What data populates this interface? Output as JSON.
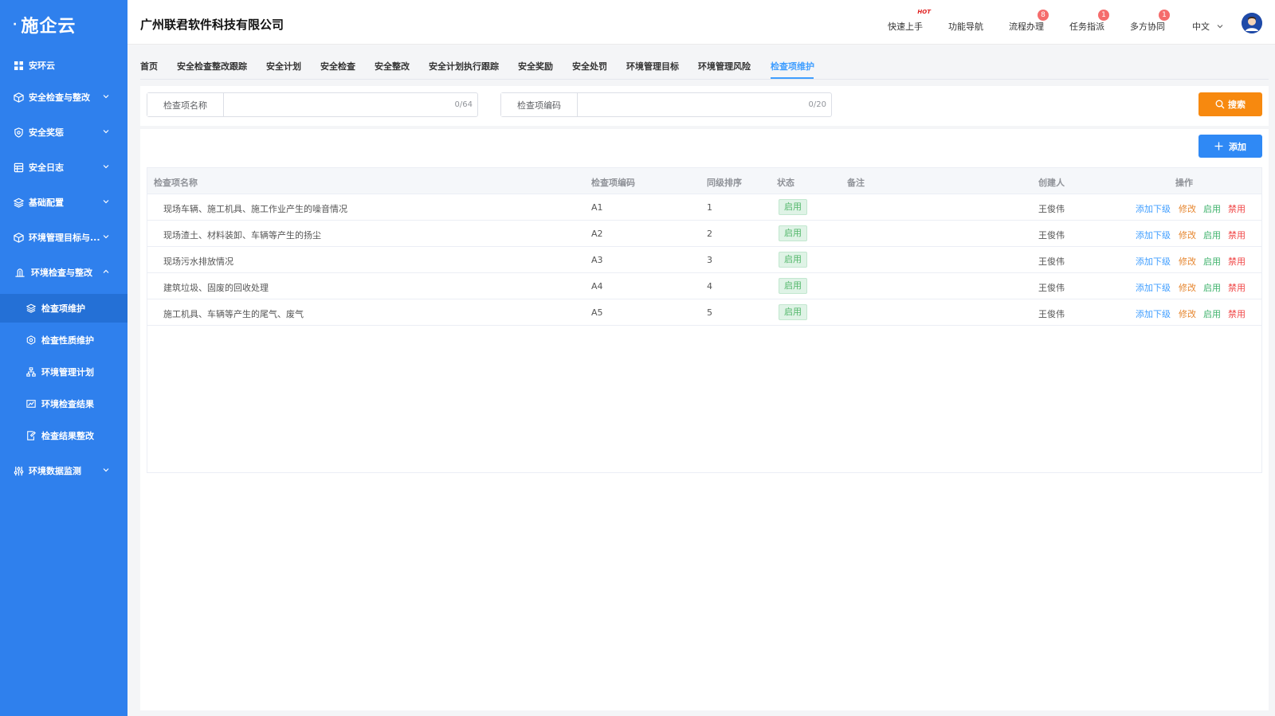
{
  "app": {
    "logo_text": "施企云",
    "company": "广州联君软件科技有限公司"
  },
  "sidebar": {
    "home": "安环云",
    "items": [
      {
        "label": "安全检查与整改",
        "icon": "cube-icon"
      },
      {
        "label": "安全奖惩",
        "icon": "shield-icon"
      },
      {
        "label": "安全日志",
        "icon": "calendar-icon"
      },
      {
        "label": "基础配置",
        "icon": "layers-icon"
      },
      {
        "label": "环境管理目标与...",
        "icon": "cube-icon"
      },
      {
        "label": "环境检查与整改",
        "icon": "plant-icon"
      },
      {
        "label": "环境数据监测",
        "icon": "sliders-icon"
      }
    ],
    "subitems": [
      {
        "label": "检查项维护",
        "icon": "layers-icon"
      },
      {
        "label": "检查性质维护",
        "icon": "hexagon-icon"
      },
      {
        "label": "环境管理计划",
        "icon": "org-chart-icon"
      },
      {
        "label": "环境检查结果",
        "icon": "chart-icon"
      },
      {
        "label": "检查结果整改",
        "icon": "document-edit-icon"
      }
    ]
  },
  "header": {
    "nav": [
      {
        "label": "快速上手",
        "badge": "HOT"
      },
      {
        "label": "功能导航",
        "badge": ""
      },
      {
        "label": "流程办理",
        "badge": "8"
      },
      {
        "label": "任务指派",
        "badge": "1"
      },
      {
        "label": "多方协同",
        "badge": "1"
      }
    ],
    "language": "中文"
  },
  "tabs": [
    "首页",
    "安全检查整改跟踪",
    "安全计划",
    "安全检查",
    "安全整改",
    "安全计划执行跟踪",
    "安全奖励",
    "安全处罚",
    "环境管理目标",
    "环境管理风险",
    "检查项维护"
  ],
  "search": {
    "name_label": "检查项名称",
    "name_value": "",
    "name_counter": "0/64",
    "code_label": "检查项编码",
    "code_value": "",
    "code_counter": "0/20",
    "button": "搜索"
  },
  "actions": {
    "add": "添加"
  },
  "table": {
    "headers": [
      "检查项名称",
      "检查项编码",
      "同级排序",
      "状态",
      "备注",
      "创建人",
      "操作"
    ],
    "rows": [
      {
        "name": "现场车辆、施工机具、施工作业产生的噪音情况",
        "code": "A1",
        "order": "1",
        "status": "启用",
        "remark": "",
        "creator": "王俊伟"
      },
      {
        "name": "现场渣土、材料装卸、车辆等产生的扬尘",
        "code": "A2",
        "order": "2",
        "status": "启用",
        "remark": "",
        "creator": "王俊伟"
      },
      {
        "name": "现场污水排放情况",
        "code": "A3",
        "order": "3",
        "status": "启用",
        "remark": "",
        "creator": "王俊伟"
      },
      {
        "name": "建筑垃圾、固废的回收处理",
        "code": "A4",
        "order": "4",
        "status": "启用",
        "remark": "",
        "creator": "王俊伟"
      },
      {
        "name": "施工机具、车辆等产生的尾气、废气",
        "code": "A5",
        "order": "5",
        "status": "启用",
        "remark": "",
        "creator": "王俊伟"
      }
    ],
    "ops": {
      "add_child": "添加下级",
      "edit": "修改",
      "enable": "启用",
      "disable": "禁用"
    }
  },
  "colors": {
    "sidebar": "#2f80ed",
    "primary": "#409eff",
    "search_button": "#f7890f",
    "status_green": "#52b76a"
  }
}
